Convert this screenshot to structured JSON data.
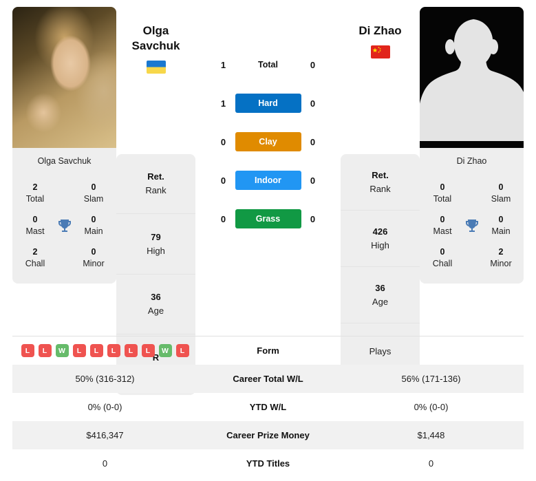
{
  "players": {
    "left": {
      "name": "Olga Savchuk",
      "name_line1": "Olga",
      "name_line2": "Savchuk",
      "flag": "ukraine-flag",
      "card_name": "Olga Savchuk",
      "info": [
        {
          "value": "Ret.",
          "label": "Rank"
        },
        {
          "value": "79",
          "label": "High"
        },
        {
          "value": "36",
          "label": "Age"
        },
        {
          "value": "R",
          "label": "Plays"
        }
      ],
      "titles": [
        {
          "value": "2",
          "label": "Total"
        },
        {
          "value": "0",
          "label": "Slam"
        },
        {
          "value": "0",
          "label": "Mast"
        },
        {
          "value": "0",
          "label": "Main"
        },
        {
          "value": "2",
          "label": "Chall"
        },
        {
          "value": "0",
          "label": "Minor"
        }
      ]
    },
    "right": {
      "name": "Di Zhao",
      "name_line1": "Di Zhao",
      "name_line2": "",
      "flag": "china-flag",
      "card_name": "Di Zhao",
      "info": [
        {
          "value": "Ret.",
          "label": "Rank"
        },
        {
          "value": "426",
          "label": "High"
        },
        {
          "value": "36",
          "label": "Age"
        },
        {
          "value": "",
          "label": "Plays"
        }
      ],
      "titles": [
        {
          "value": "0",
          "label": "Total"
        },
        {
          "value": "0",
          "label": "Slam"
        },
        {
          "value": "0",
          "label": "Mast"
        },
        {
          "value": "0",
          "label": "Main"
        },
        {
          "value": "0",
          "label": "Chall"
        },
        {
          "value": "2",
          "label": "Minor"
        }
      ]
    }
  },
  "head_to_head": [
    {
      "left": "1",
      "label": "Total",
      "right": "0",
      "color": ""
    },
    {
      "left": "1",
      "label": "Hard",
      "right": "0",
      "color": "#0571c4"
    },
    {
      "left": "0",
      "label": "Clay",
      "right": "0",
      "color": "#e08b00"
    },
    {
      "left": "0",
      "label": "Indoor",
      "right": "0",
      "color": "#2196f3"
    },
    {
      "left": "0",
      "label": "Grass",
      "right": "0",
      "color": "#119944"
    }
  ],
  "form": {
    "label": "Form",
    "left_results": [
      "L",
      "L",
      "W",
      "L",
      "L",
      "L",
      "L",
      "L",
      "W",
      "L"
    ],
    "right_results": [],
    "win_color": "#66bb6a",
    "loss_color": "#ef5350"
  },
  "table_rows": [
    {
      "left": "50% (316-312)",
      "label": "Career Total W/L",
      "right": "56% (171-136)"
    },
    {
      "left": "0% (0-0)",
      "label": "YTD W/L",
      "right": "0% (0-0)"
    },
    {
      "left": "$416,347",
      "label": "Career Prize Money",
      "right": "$1,448"
    },
    {
      "left": "0",
      "label": "YTD Titles",
      "right": "0"
    }
  ],
  "icons": {
    "trophy": "trophy-icon",
    "trophy_color": "#4a7bb5"
  }
}
